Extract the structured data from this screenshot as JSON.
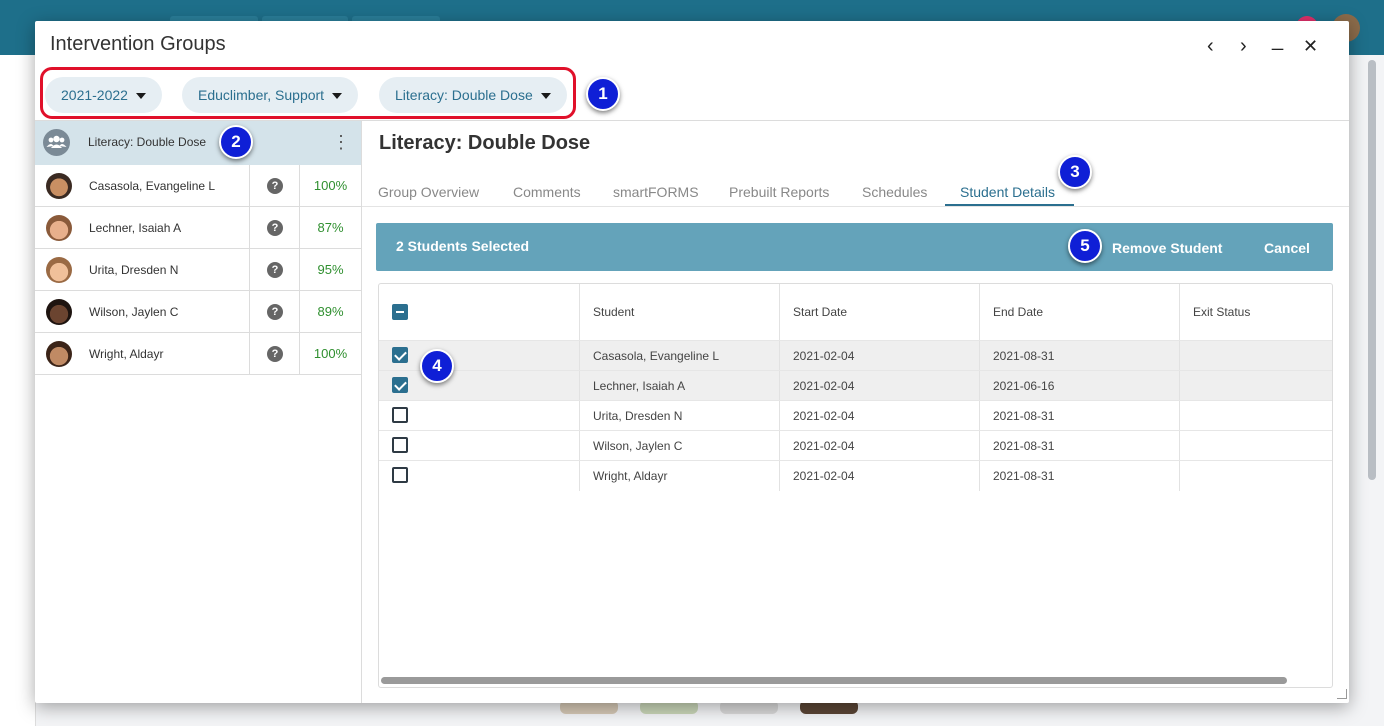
{
  "dialog": {
    "title": "Intervention Groups",
    "controls": {
      "prev": "‹",
      "next": "›",
      "minimize": "_",
      "close": "✕"
    }
  },
  "filters": [
    {
      "label": "2021-2022",
      "icon": "caret-down-icon"
    },
    {
      "label": "Educlimber, Support",
      "icon": "caret-down-icon"
    },
    {
      "label": "Literacy: Double Dose",
      "icon": "caret-down-icon"
    }
  ],
  "markers": [
    "1",
    "2",
    "3",
    "4",
    "5"
  ],
  "sidebar": {
    "group": {
      "name": "Literacy: Double Dose",
      "icon": "group-users-icon",
      "menu_icon": "⋮"
    },
    "students": [
      {
        "name": "Casasola, Evangeline L",
        "pct": "100%",
        "help": "?"
      },
      {
        "name": "Lechner, Isaiah A",
        "pct": "87%",
        "help": "?"
      },
      {
        "name": "Urita, Dresden N",
        "pct": "95%",
        "help": "?"
      },
      {
        "name": "Wilson, Jaylen C",
        "pct": "89%",
        "help": "?"
      },
      {
        "name": "Wright, Aldayr",
        "pct": "100%",
        "help": "?"
      }
    ]
  },
  "main": {
    "title": "Literacy: Double Dose",
    "tabs": [
      {
        "label": "Group Overview",
        "active": false
      },
      {
        "label": "Comments",
        "active": false
      },
      {
        "label": "smartFORMS",
        "active": false
      },
      {
        "label": "Prebuilt Reports",
        "active": false
      },
      {
        "label": "Schedules",
        "active": false
      },
      {
        "label": "Student Details",
        "active": true
      }
    ],
    "action_bar": {
      "selected_text": "2 Students Selected",
      "remove_label": "Remove Student",
      "cancel_label": "Cancel"
    },
    "table": {
      "columns": [
        "Student",
        "Start Date",
        "End Date",
        "Exit Status"
      ],
      "rows": [
        {
          "student": "Casasola, Evangeline L",
          "start": "2021-02-04",
          "end": "2021-08-31",
          "exit": "",
          "checked": true
        },
        {
          "student": "Lechner, Isaiah A",
          "start": "2021-02-04",
          "end": "2021-06-16",
          "exit": "",
          "checked": true
        },
        {
          "student": "Urita, Dresden N",
          "start": "2021-02-04",
          "end": "2021-08-31",
          "exit": "",
          "checked": false
        },
        {
          "student": "Wilson, Jaylen C",
          "start": "2021-02-04",
          "end": "2021-08-31",
          "exit": "",
          "checked": false
        },
        {
          "student": "Wright, Aldayr",
          "start": "2021-02-04",
          "end": "2021-08-31",
          "exit": "",
          "checked": false
        }
      ]
    }
  },
  "colors": {
    "accent": "#2b6f8f",
    "action_bar": "#64a3ba",
    "highlight": "#e0102a",
    "marker": "#0f1fd6",
    "pct": "#2f8f2f"
  }
}
